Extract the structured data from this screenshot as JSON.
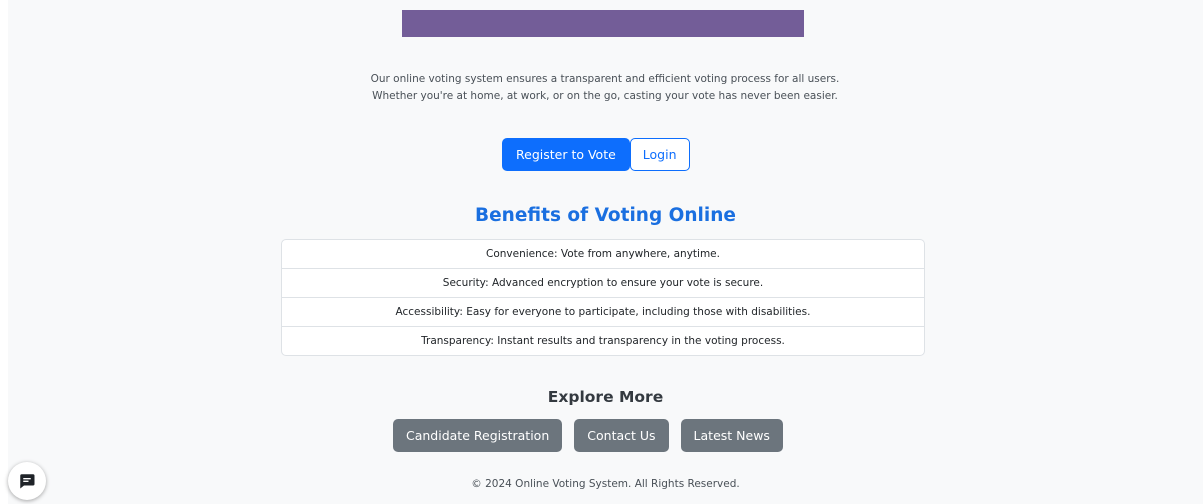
{
  "intro": {
    "text": "Our online voting system ensures a transparent and efficient voting process for all users. Whether you're at home, at work, or on the go, casting your vote has never been easier."
  },
  "actions": {
    "register_label": "Register to Vote",
    "login_label": "Login"
  },
  "benefits": {
    "title": "Benefits of Voting Online",
    "items": [
      "Convenience: Vote from anywhere, anytime.",
      "Security: Advanced encryption to ensure your vote is secure.",
      "Accessibility: Easy for everyone to participate, including those with disabilities.",
      "Transparency: Instant results and transparency in the voting process."
    ]
  },
  "explore": {
    "title": "Explore More",
    "links": [
      "Candidate Registration",
      "Contact Us",
      "Latest News"
    ]
  },
  "footer": {
    "text": "© 2024 Online Voting System. All Rights Reserved."
  },
  "colors": {
    "primary": "#0d6efd",
    "secondary": "#6c757d",
    "hero": "#735d98",
    "heading": "#1a6fe0"
  },
  "icons": {
    "chat": "chat-icon"
  }
}
